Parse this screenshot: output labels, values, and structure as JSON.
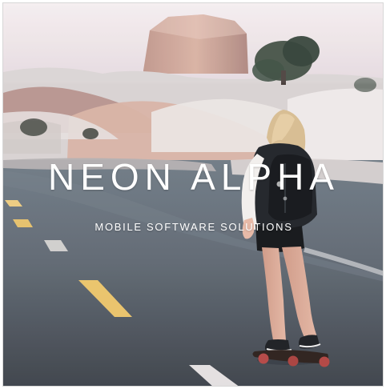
{
  "logo": {
    "title": "NEON ALPHA",
    "subtitle": "MOBILE SOFTWARE SOLUTIONS"
  },
  "colors": {
    "title_text": "#ffffff",
    "sky": "#efe5e8",
    "road": "#56606a",
    "lane_marking": "#f0c86a"
  },
  "photo": {
    "subject": "skateboarder-on-road",
    "setting": "desert-road-with-snowy-red-rock"
  }
}
